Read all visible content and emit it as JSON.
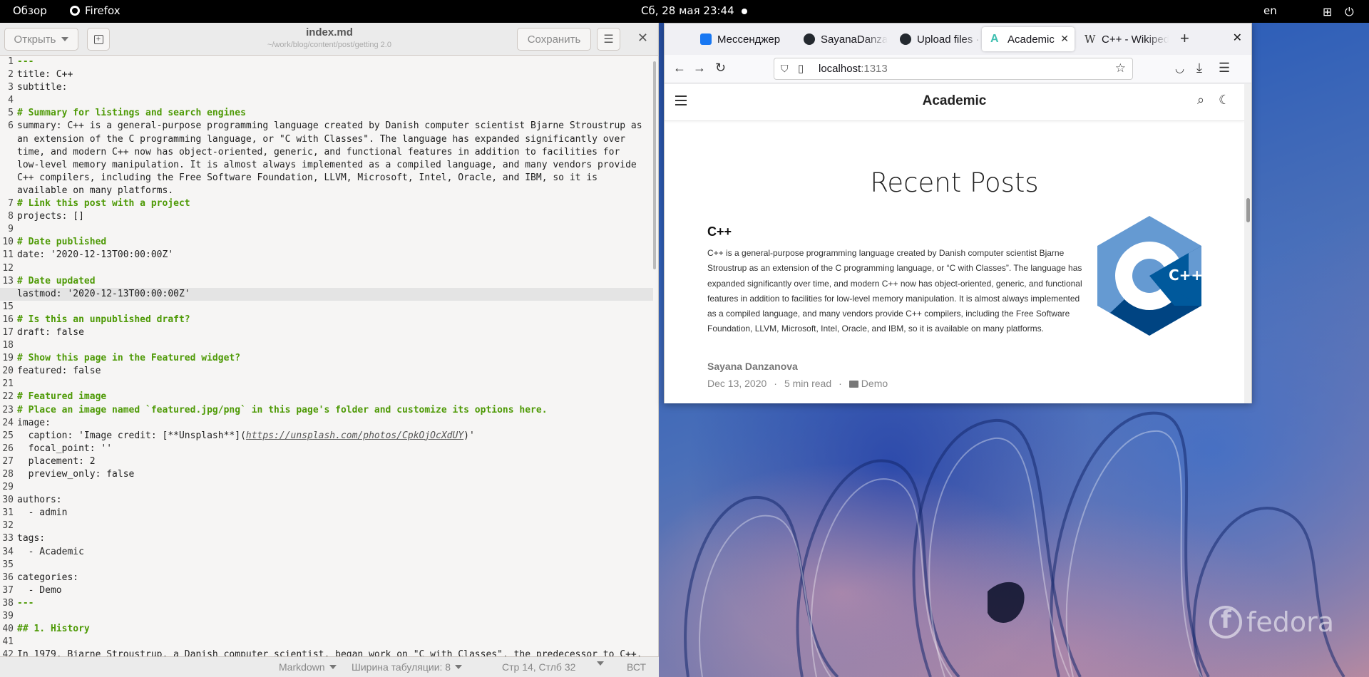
{
  "topbar": {
    "activities": "Обзор",
    "app_name": "Firefox",
    "datetime": "Сб, 28 мая  23:44",
    "lang": "en"
  },
  "editor": {
    "open_label": "Открыть",
    "title": "index.md",
    "path": "~/work/blog/content/post/getting 2.0",
    "save_label": "Сохранить",
    "lines": [
      [
        {
          "t": "---",
          "c": "hr"
        }
      ],
      [
        {
          "t": "title: C++"
        }
      ],
      [
        {
          "t": "subtitle:"
        }
      ],
      [
        {
          "t": ""
        }
      ],
      [
        {
          "t": "# Summary for listings and search engines",
          "c": "cm"
        }
      ],
      [
        {
          "t": "summary: C++ is a general-purpose programming language created by Danish computer scientist Bjarne Stroustrup as"
        }
      ],
      [
        {
          "t": "an extension of the C programming language, or \"C with Classes\". The language has expanded significantly over"
        }
      ],
      [
        {
          "t": "time, and modern C++ now has object-oriented, generic, and functional features in addition to facilities for"
        }
      ],
      [
        {
          "t": "low-level memory manipulation. It is almost always implemented as a compiled language, and many vendors provide"
        }
      ],
      [
        {
          "t": "C++ compilers, including the Free Software Foundation, LLVM, Microsoft, Intel, Oracle, and IBM, so it is"
        }
      ],
      [
        {
          "t": "available on many platforms."
        }
      ],
      [
        {
          "t": "# Link this post with a project",
          "c": "cm"
        }
      ],
      [
        {
          "t": "projects: []"
        }
      ],
      [
        {
          "t": ""
        }
      ],
      [
        {
          "t": "# Date published",
          "c": "cm"
        }
      ],
      [
        {
          "t": "date: '2020-12-13T00:00:00Z'"
        }
      ],
      [
        {
          "t": ""
        }
      ],
      [
        {
          "t": "# Date updated",
          "c": "cm"
        }
      ],
      [
        {
          "t": "lastmod: '2020-12-13T00:00:00Z'"
        }
      ],
      [
        {
          "t": ""
        }
      ],
      [
        {
          "t": "# Is this an unpublished draft?",
          "c": "cm"
        }
      ],
      [
        {
          "t": "draft: false"
        }
      ],
      [
        {
          "t": ""
        }
      ],
      [
        {
          "t": "# Show this page in the Featured widget?",
          "c": "cm"
        }
      ],
      [
        {
          "t": "featured: false"
        }
      ],
      [
        {
          "t": ""
        }
      ],
      [
        {
          "t": "# Featured image",
          "c": "cm"
        }
      ],
      [
        {
          "t": "# Place an image named `featured.jpg/png` in this page's folder and customize its options here.",
          "c": "cm"
        }
      ],
      [
        {
          "t": "image:"
        }
      ],
      [
        {
          "t": "  caption: 'Image credit: [**Unsplash**]("
        },
        {
          "t": "https://unsplash.com/photos/CpkOjOcXdUY",
          "c": "link"
        },
        {
          "t": ")'"
        }
      ],
      [
        {
          "t": "  focal_point: ''"
        }
      ],
      [
        {
          "t": "  placement: 2"
        }
      ],
      [
        {
          "t": "  preview_only: false"
        }
      ],
      [
        {
          "t": ""
        }
      ],
      [
        {
          "t": "authors:"
        }
      ],
      [
        {
          "t": "  - admin"
        }
      ],
      [
        {
          "t": ""
        }
      ],
      [
        {
          "t": "tags:"
        }
      ],
      [
        {
          "t": "  - Academic"
        }
      ],
      [
        {
          "t": ""
        }
      ],
      [
        {
          "t": "categories:"
        }
      ],
      [
        {
          "t": "  - Demo"
        }
      ],
      [
        {
          "t": "---",
          "c": "hr"
        }
      ],
      [
        {
          "t": ""
        }
      ],
      [
        {
          "t": "## 1. History",
          "c": "cm"
        }
      ],
      [
        {
          "t": ""
        }
      ],
      [
        {
          "t": "In 1979, Bjarne Stroustrup, a Danish computer scientist, began work on \"C with Classes\", the predecessor to C++."
        }
      ]
    ],
    "line_numbers": [
      "1",
      "2",
      "3",
      "4",
      "5",
      "6",
      "",
      "",
      "",
      "",
      "",
      "7",
      "8",
      "9",
      "10",
      "11",
      "12",
      "13",
      "14",
      "15",
      "16",
      "17",
      "18",
      "19",
      "20",
      "21",
      "22",
      "23",
      "24",
      "25",
      "26",
      "27",
      "28",
      "29",
      "30",
      "31",
      "32",
      "33",
      "34",
      "35",
      "36",
      "37",
      "38",
      "39",
      "40",
      "41",
      "42"
    ],
    "current_line": "14",
    "status": {
      "language": "Markdown",
      "tab_width": "Ширина табуляции: 8",
      "position": "Стр 14, Стлб 32",
      "mode": "ВСТ"
    }
  },
  "browser": {
    "tabs": [
      {
        "label": "Мессенджер",
        "icon": "messenger-icon",
        "color": "#1877f2"
      },
      {
        "label": "SayanaDanzanova",
        "icon": "github-icon",
        "color": "#24292f"
      },
      {
        "label": "Upload files · Sa",
        "icon": "github-icon",
        "color": "#24292f"
      },
      {
        "label": "Academic",
        "icon": "academic-icon",
        "color": "#3ebfb0",
        "active": true
      },
      {
        "label": "C++ - Wikipedia",
        "icon": "wikipedia-icon",
        "color": "#333333"
      }
    ],
    "url_host": "localhost",
    "url_port": ":1313",
    "page": {
      "site_title": "Academic",
      "section_title": "Recent Posts",
      "post_title": "C++",
      "post_summary": "C++ is a general-purpose programming language created by Danish computer scientist Bjarne Stroustrup as an extension of the C programming language, or “C with Classes”. The language has expanded significantly over time, and modern C++ now has object-oriented, generic, and functional features in addition to facilities for low-level memory manipulation. It is almost always implemented as a compiled language, and many vendors provide C++ compilers, including the Free Software Foundation, LLVM, Microsoft, Intel, Oracle, and IBM, so it is available on many platforms.",
      "author": "Sayana Danzanova",
      "date": "Dec 13, 2020",
      "read_time": "5 min read",
      "category": "Demo",
      "logo_text": "C++"
    }
  },
  "wallpaper": {
    "brand": "fedora"
  },
  "colors": {
    "comment_green": "#4e9a06",
    "cpp_blue": "#659ad2",
    "cpp_dark": "#004482"
  }
}
